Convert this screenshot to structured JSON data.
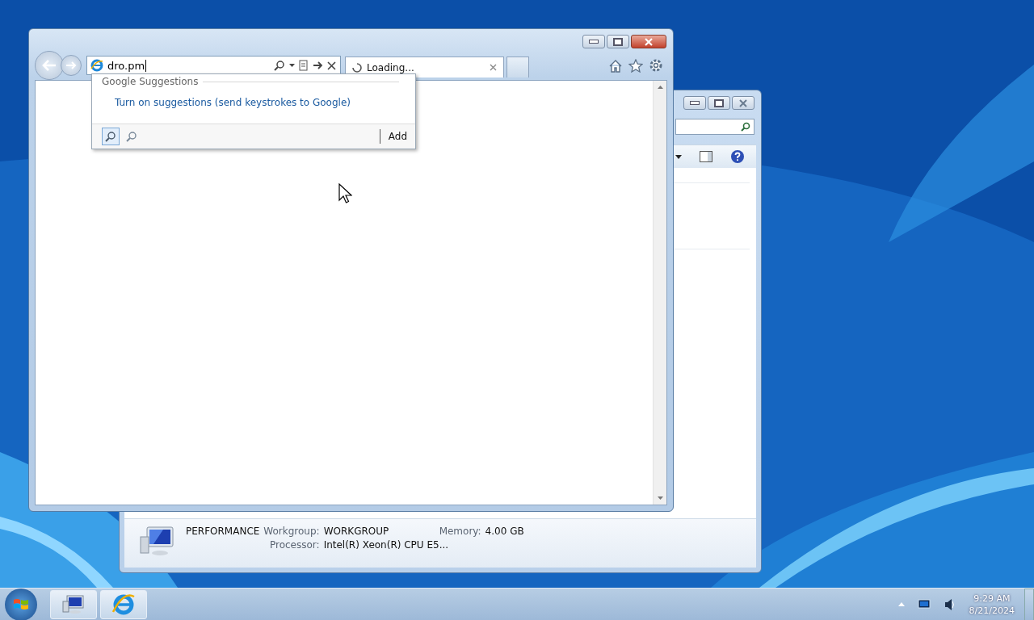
{
  "ie_window": {
    "address": "dro.pm",
    "tabs": [
      {
        "label": "Loading...",
        "selected": true
      }
    ],
    "suggestions": {
      "heading": "Google Suggestions",
      "link": "Turn on suggestions (send keystrokes to Google)",
      "add_button": "Add"
    }
  },
  "explorer_window": {
    "computer_name": "PERFORMANCE",
    "details": [
      {
        "label": "Workgroup:",
        "value": "WORKGROUP"
      },
      {
        "label": "Memory:",
        "value": "4.00 GB"
      },
      {
        "label": "Processor:",
        "value": "Intel(R) Xeon(R) CPU E5..."
      }
    ]
  },
  "taskbar": {
    "apps": [
      {
        "kind": "computer"
      },
      {
        "kind": "browser"
      }
    ],
    "time": "9:29 AM",
    "date": "8/21/2024"
  }
}
